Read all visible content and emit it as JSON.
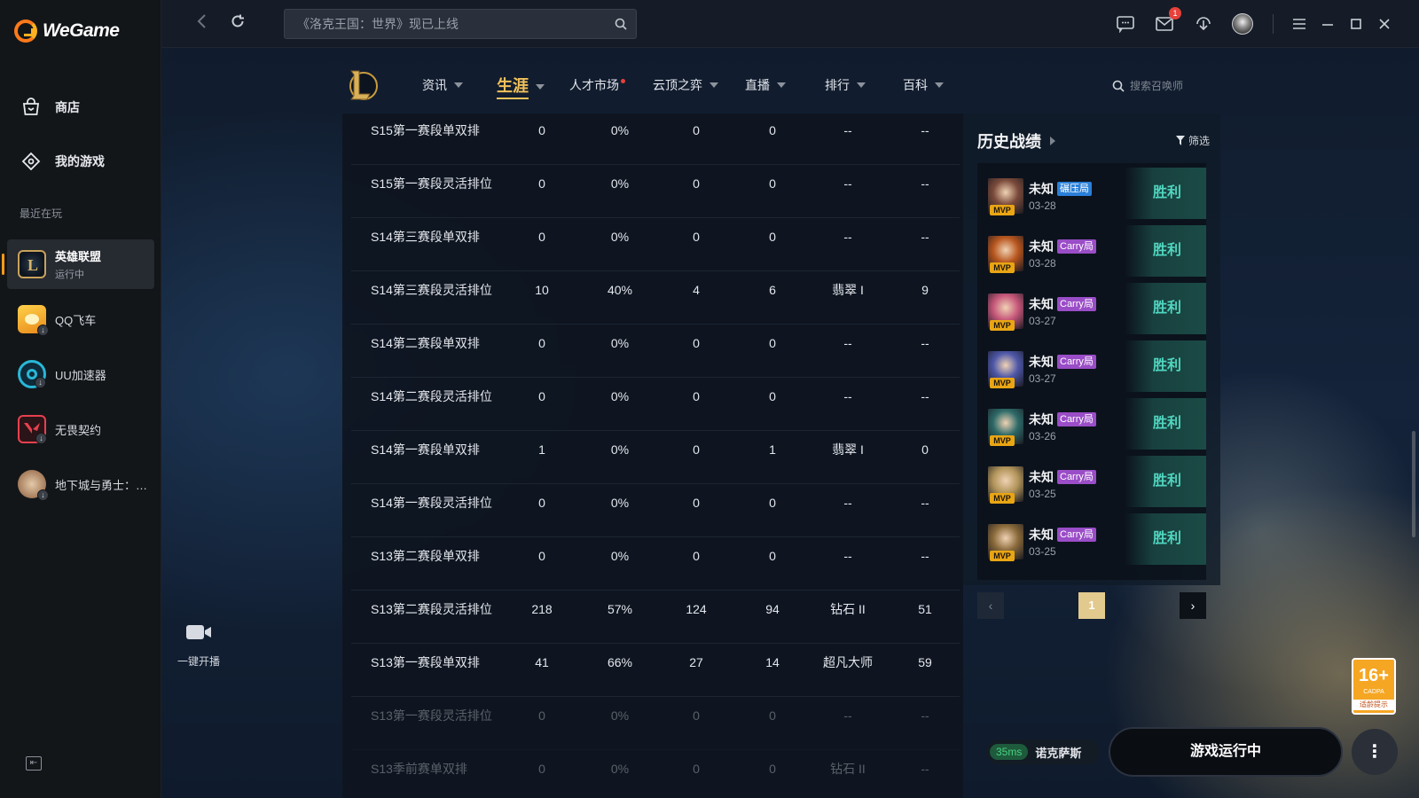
{
  "app": {
    "name": "WeGame"
  },
  "sidebar": {
    "nav": [
      {
        "label": "商店",
        "icon": "shop-bag-icon"
      },
      {
        "label": "我的游戏",
        "icon": "gamepad-icon"
      }
    ],
    "recent_label": "最近在玩",
    "games": [
      {
        "name": "英雄联盟",
        "status": "运行中",
        "icon": "lol-icon"
      },
      {
        "name": "QQ飞车",
        "icon": "qq-speed-icon"
      },
      {
        "name": "UU加速器",
        "icon": "uu-accelerator-icon"
      },
      {
        "name": "无畏契约",
        "icon": "valorant-icon"
      },
      {
        "name": "地下城与勇士：…",
        "icon": "dnf-icon"
      }
    ]
  },
  "topbar": {
    "search_placeholder": "《洛克王国：世界》现已上线",
    "mail_badge": "1"
  },
  "game_nav": {
    "items": [
      {
        "label": "资讯",
        "caret": true
      },
      {
        "label": "生涯",
        "caret": true,
        "active": true
      },
      {
        "label": "人才市场",
        "dot": true
      },
      {
        "label": "云顶之弈",
        "caret": true
      },
      {
        "label": "直播",
        "caret": true
      },
      {
        "label": "排行",
        "caret": true
      },
      {
        "label": "百科",
        "caret": true
      }
    ],
    "summoner_search_placeholder": "搜索召唤师"
  },
  "stats_table": {
    "rows": [
      [
        "S15第一赛段单双排",
        "0",
        "0%",
        "0",
        "0",
        "--",
        "--"
      ],
      [
        "S15第一赛段灵活排位",
        "0",
        "0%",
        "0",
        "0",
        "--",
        "--"
      ],
      [
        "S14第三赛段单双排",
        "0",
        "0%",
        "0",
        "0",
        "--",
        "--"
      ],
      [
        "S14第三赛段灵活排位",
        "10",
        "40%",
        "4",
        "6",
        "翡翠 I",
        "9"
      ],
      [
        "S14第二赛段单双排",
        "0",
        "0%",
        "0",
        "0",
        "--",
        "--"
      ],
      [
        "S14第二赛段灵活排位",
        "0",
        "0%",
        "0",
        "0",
        "--",
        "--"
      ],
      [
        "S14第一赛段单双排",
        "1",
        "0%",
        "0",
        "1",
        "翡翠 I",
        "0"
      ],
      [
        "S14第一赛段灵活排位",
        "0",
        "0%",
        "0",
        "0",
        "--",
        "--"
      ],
      [
        "S13第二赛段单双排",
        "0",
        "0%",
        "0",
        "0",
        "--",
        "--"
      ],
      [
        "S13第二赛段灵活排位",
        "218",
        "57%",
        "124",
        "94",
        "钻石 II",
        "51"
      ],
      [
        "S13第一赛段单双排",
        "41",
        "66%",
        "27",
        "14",
        "超凡大师",
        "59"
      ],
      [
        "S13第一赛段灵活排位",
        "0",
        "0%",
        "0",
        "0",
        "--",
        "--"
      ],
      [
        "S13季前赛单双排",
        "0",
        "0%",
        "0",
        "0",
        "钻石 II",
        "--"
      ]
    ]
  },
  "history": {
    "title": "历史战绩",
    "filter_label": "筛选",
    "matches": [
      {
        "name": "未知",
        "tag": "碾压局",
        "tag_color": "blue",
        "date": "03-28",
        "result": "胜利",
        "mvp": "MVP",
        "champ_color": "#7a4a3a"
      },
      {
        "name": "未知",
        "tag": "Carry局",
        "tag_color": "purple",
        "date": "03-28",
        "result": "胜利",
        "mvp": "MVP",
        "champ_color": "#b8561e"
      },
      {
        "name": "未知",
        "tag": "Carry局",
        "tag_color": "purple",
        "date": "03-27",
        "result": "胜利",
        "mvp": "MVP",
        "champ_color": "#c6577a"
      },
      {
        "name": "未知",
        "tag": "Carry局",
        "tag_color": "purple",
        "date": "03-27",
        "result": "胜利",
        "mvp": "MVP",
        "champ_color": "#4d57a8"
      },
      {
        "name": "未知",
        "tag": "Carry局",
        "tag_color": "purple",
        "date": "03-26",
        "result": "胜利",
        "mvp": "MVP",
        "champ_color": "#2d6a68"
      },
      {
        "name": "未知",
        "tag": "Carry局",
        "tag_color": "purple",
        "date": "03-25",
        "result": "胜利",
        "mvp": "MVP",
        "champ_color": "#b2955a"
      },
      {
        "name": "未知",
        "tag": "Carry局",
        "tag_color": "purple",
        "date": "03-25",
        "result": "胜利",
        "mvp": "MVP",
        "champ_color": "#8a6a3a"
      }
    ],
    "pager": {
      "current": "1"
    }
  },
  "broadcast": {
    "label": "一键开播"
  },
  "age_rating": {
    "number": "16+",
    "small": "CADPA",
    "tip": "适龄提示"
  },
  "status": {
    "ping": "35ms",
    "server": "诺克萨斯",
    "run_button": "游戏运行中",
    "more": "⋮"
  }
}
